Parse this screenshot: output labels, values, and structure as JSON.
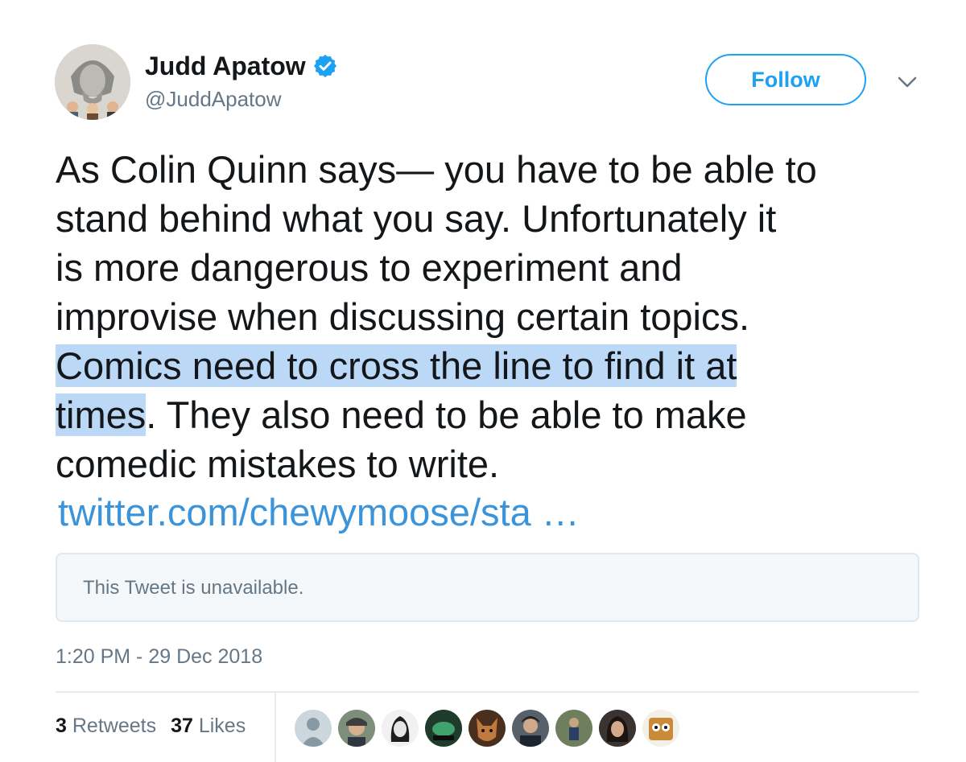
{
  "author": {
    "name": "Judd Apatow",
    "handle": "@JuddApatow",
    "verified": true
  },
  "follow_label": "Follow",
  "tweet": {
    "lines": [
      "As Colin Quinn says— you have to be able to",
      "stand behind what you say.  Unfortunately it",
      "is more dangerous to experiment and",
      "improvise when discussing certain topics."
    ],
    "highlighted_1": "Comics need to cross the line to find it at",
    "highlighted_2": "times",
    "line6_rest": ".  They also need to be able to make",
    "line7": "comedic mistakes to write.",
    "link": "twitter.com/chewymoose/sta …"
  },
  "quoted_tweet": {
    "text": "This Tweet is unavailable."
  },
  "timestamp": "1:20 PM - 29 Dec 2018",
  "stats": {
    "retweets_count": "3",
    "retweets_label": "Retweets",
    "likes_count": "37",
    "likes_label": "Likes"
  },
  "colors": {
    "accent": "#1da1f2",
    "link": "#3b94d9",
    "text_secondary": "#657786",
    "selection": "#bcd8f7"
  },
  "icons": {
    "verified": "verified-badge-icon",
    "caret": "chevron-down-icon"
  }
}
